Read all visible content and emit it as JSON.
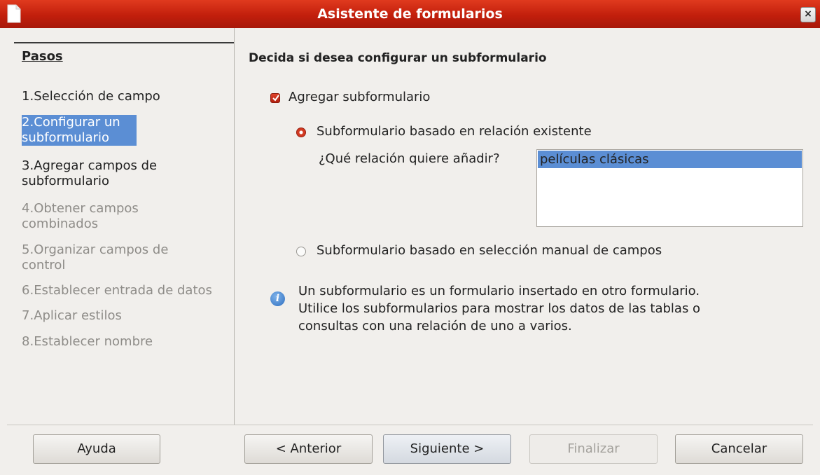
{
  "window": {
    "title": "Asistente de formularios",
    "close_glyph": "×"
  },
  "steps": {
    "header": "Pasos",
    "items": [
      {
        "num": "1.",
        "label": "Selección de campo",
        "state": "enabled"
      },
      {
        "num": "2.",
        "label": "Configurar un subformulario",
        "state": "selected"
      },
      {
        "num": "3.",
        "label": "Agregar campos de subformulario",
        "state": "enabled"
      },
      {
        "num": "4.",
        "label": "Obtener campos combinados",
        "state": "disabled"
      },
      {
        "num": "5.",
        "label": "Organizar campos de control",
        "state": "disabled"
      },
      {
        "num": "6.",
        "label": "Establecer entrada de datos",
        "state": "disabled"
      },
      {
        "num": "7.",
        "label": "Aplicar estilos",
        "state": "disabled"
      },
      {
        "num": "8.",
        "label": "Establecer nombre",
        "state": "disabled"
      }
    ]
  },
  "main": {
    "heading": "Decida si desea configurar un subformulario",
    "add_subform": {
      "label": "Agregar subformulario",
      "checked": true
    },
    "radio_existing": {
      "label": "Subformulario basado en relación existente",
      "selected": true
    },
    "relation_prompt": "¿Qué relación quiere añadir?",
    "relations": [
      "películas clásicas"
    ],
    "radio_manual": {
      "label": "Subformulario basado en selección manual de campos",
      "selected": false
    },
    "info_lines": [
      "Un subformulario es un formulario insertado en otro formulario.",
      "Utilice los subformularios para mostrar los datos de las tablas o",
      "consultas con una relación de uno a varios."
    ]
  },
  "buttons": {
    "help": "Ayuda",
    "back": "< Anterior",
    "next": "Siguiente >",
    "finish": "Finalizar",
    "cancel": "Cancelar"
  },
  "icons": {
    "app": "document-icon",
    "close": "close-icon",
    "check": "checkmark-icon",
    "info": "info-icon"
  },
  "colors": {
    "titlebar": "#c21f0c",
    "selection": "#5b8ed4",
    "dialog_bg": "#f1efec",
    "accent_red": "#d23a22",
    "disabled_text": "#8e8c88"
  }
}
